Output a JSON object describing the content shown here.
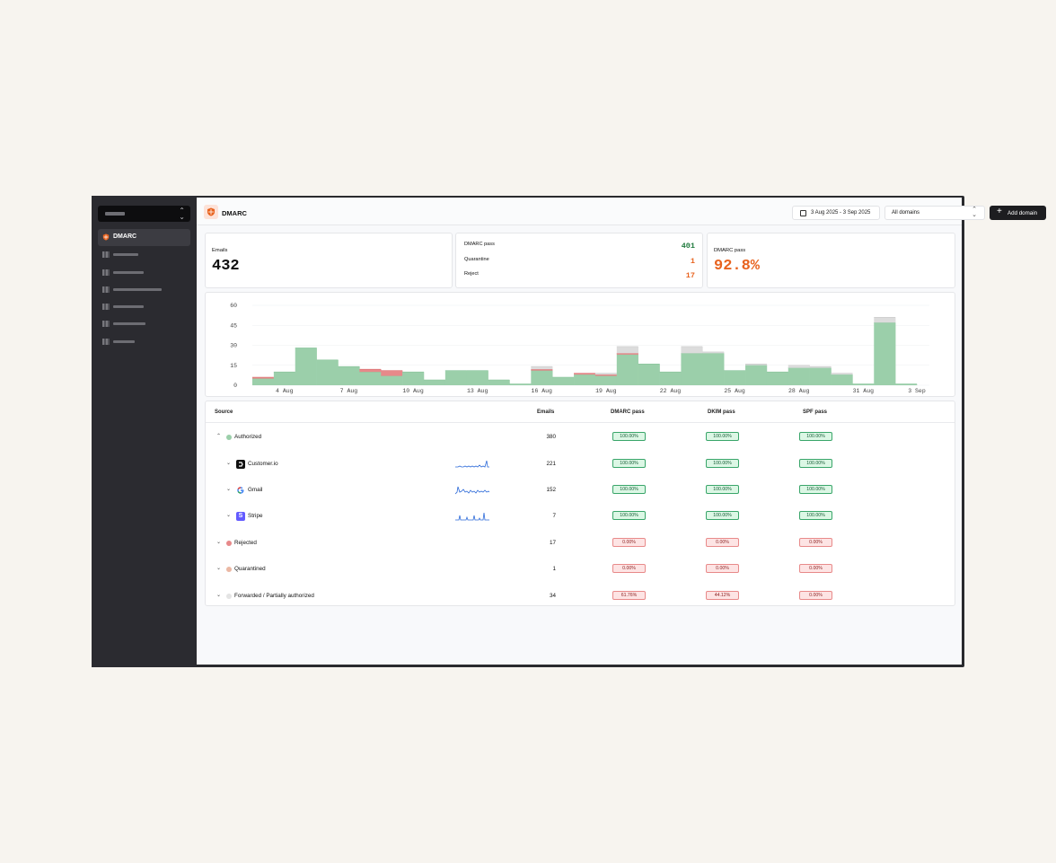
{
  "sidebar": {
    "active_item": {
      "label": "DMARC",
      "icon": "shield-icon"
    }
  },
  "header": {
    "title": "DMARC",
    "date_range": "3 Aug 2025 - 3 Sep 2025",
    "domain_select": "All domains",
    "add_button": "Add domain"
  },
  "stats": {
    "emails_label": "Emails",
    "emails_value": "432",
    "dmarc_pass_label": "DMARC pass",
    "dmarc_pass_value": "401",
    "quarantine_label": "Quarantine",
    "quarantine_value": "1",
    "reject_label": "Reject",
    "reject_value": "17",
    "pass_rate_label": "DMARC pass",
    "pass_rate_value": "92.8%"
  },
  "colors": {
    "authorized": "#9bcfaa",
    "rejected": "#e7898a",
    "forwarded": "#dcdcdc",
    "green": "#1f7a3d",
    "orange": "#e8631f",
    "accent": "#e8631f"
  },
  "chart_data": {
    "type": "bar",
    "stacked": true,
    "categories": [
      "3 Aug",
      "4 Aug",
      "5 Aug",
      "6 Aug",
      "7 Aug",
      "8 Aug",
      "9 Aug",
      "10 Aug",
      "11 Aug",
      "12 Aug",
      "13 Aug",
      "14 Aug",
      "15 Aug",
      "16 Aug",
      "17 Aug",
      "18 Aug",
      "19 Aug",
      "20 Aug",
      "21 Aug",
      "22 Aug",
      "23 Aug",
      "24 Aug",
      "25 Aug",
      "26 Aug",
      "27 Aug",
      "28 Aug",
      "29 Aug",
      "30 Aug",
      "31 Aug",
      "1 Sep",
      "2 Sep",
      "3 Sep"
    ],
    "x_tick_labels": [
      "4 Aug",
      "7 Aug",
      "10 Aug",
      "13 Aug",
      "16 Aug",
      "19 Aug",
      "22 Aug",
      "25 Aug",
      "28 Aug",
      "31 Aug",
      "3 Sep"
    ],
    "series": [
      {
        "name": "Authorized",
        "values": [
          5,
          10,
          28,
          19,
          14,
          10,
          7,
          10,
          4,
          11,
          11,
          4,
          1,
          11,
          6,
          8,
          7,
          23,
          16,
          10,
          24,
          24,
          11,
          15,
          10,
          13,
          13,
          8,
          1,
          47,
          1,
          0
        ]
      },
      {
        "name": "Rejected",
        "values": [
          1,
          0,
          0,
          0,
          0,
          2,
          4,
          0,
          0,
          0,
          0,
          0,
          0,
          1,
          0,
          1,
          1,
          1,
          0,
          0,
          0,
          0,
          0,
          0,
          0,
          0,
          0,
          0,
          0,
          0,
          0,
          0
        ]
      },
      {
        "name": "Forwarded / Partially authorized",
        "values": [
          0,
          0,
          0,
          0,
          0,
          0,
          0,
          0,
          0,
          0,
          0,
          0,
          0,
          2,
          0,
          0,
          1,
          5,
          0,
          0,
          5,
          1,
          0,
          1,
          0,
          2,
          1,
          1,
          0,
          4,
          0,
          0
        ]
      }
    ],
    "y_ticks": [
      0,
      15,
      30,
      45,
      60
    ],
    "ylim": [
      0,
      60
    ]
  },
  "table": {
    "headers": {
      "source": "Source",
      "emails": "Emails",
      "dmarc": "DMARC pass",
      "dkim": "DKIM pass",
      "spf": "SPF pass"
    },
    "rows": [
      {
        "name": "Authorized",
        "emails": "380",
        "dmarc": "100.00%",
        "dkim": "100.00%",
        "spf": "100.00%"
      },
      {
        "name": "Customer.io",
        "emails": "221",
        "dmarc": "100.00%",
        "dkim": "100.00%",
        "spf": "100.00%"
      },
      {
        "name": "Gmail",
        "emails": "152",
        "dmarc": "100.00%",
        "dkim": "100.00%",
        "spf": "100.00%"
      },
      {
        "name": "Stripe",
        "emails": "7",
        "dmarc": "100.00%",
        "dkim": "100.00%",
        "spf": "100.00%"
      },
      {
        "name": "Rejected",
        "emails": "17",
        "dmarc": "0.00%",
        "dkim": "0.00%",
        "spf": "0.00%"
      },
      {
        "name": "Quarantined",
        "emails": "1",
        "dmarc": "0.00%",
        "dkim": "0.00%",
        "spf": "0.00%"
      },
      {
        "name": "Forwarded / Partially authorized",
        "emails": "34",
        "dmarc": "61.76%",
        "dkim": "44.12%",
        "spf": "0.00%"
      }
    ]
  }
}
